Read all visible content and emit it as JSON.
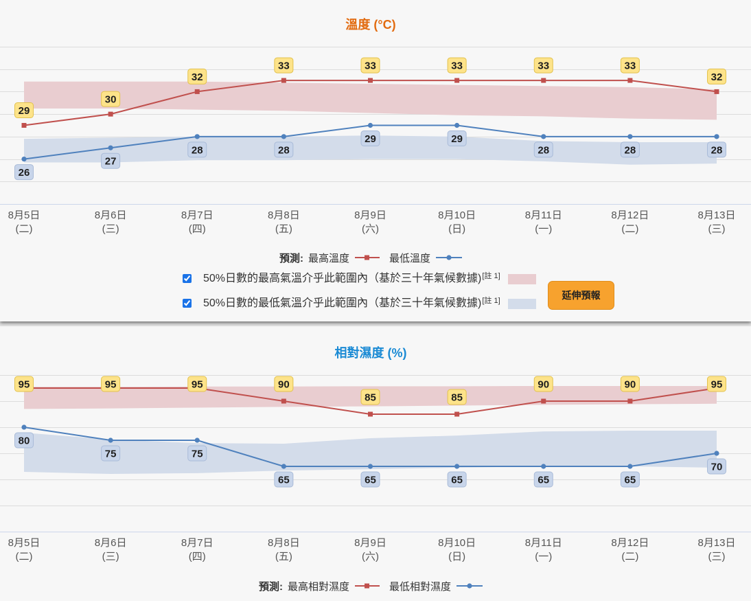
{
  "chart_data": [
    {
      "type": "line",
      "title": "溫度 (°C)",
      "title_color": "#e26b10",
      "categories": [
        "8月5日",
        "8月6日",
        "8月7日",
        "8月8日",
        "8月9日",
        "8月10日",
        "8月11日",
        "8月12日",
        "8月13日"
      ],
      "weekdays": [
        "(二)",
        "(三)",
        "(四)",
        "(五)",
        "(六)",
        "(日)",
        "(一)",
        "(二)",
        "(三)"
      ],
      "series": [
        {
          "name": "最高溫度",
          "values": [
            29,
            30,
            32,
            33,
            33,
            33,
            33,
            33,
            32
          ],
          "color": "#c0504d"
        },
        {
          "name": "最低溫度",
          "values": [
            26,
            27,
            28,
            28,
            29,
            29,
            28,
            28,
            28
          ],
          "color": "#4f81bd"
        }
      ],
      "bands": [
        {
          "label": "50%日數的最高氣溫介乎此範圍內（基於三十年氣候數據)",
          "note": "[註 1]",
          "checked": true,
          "color": "#e9cdd0",
          "upper": [
            32.9,
            32.9,
            32.9,
            32.8,
            32.7,
            32.6,
            32.5,
            32.4,
            32.2
          ],
          "lower": [
            30.5,
            30.5,
            30.4,
            30.3,
            30.1,
            29.9,
            29.8,
            29.6,
            29.5
          ]
        },
        {
          "label": "50%日數的最低氣溫介乎此範圍內（基於三十年氣候數據)",
          "note": "[註 1]",
          "checked": true,
          "color": "#d3dcea",
          "upper": [
            27.8,
            27.9,
            28.0,
            28.0,
            28.1,
            28.0,
            27.6,
            27.5,
            27.5
          ],
          "lower": [
            25.7,
            25.7,
            25.9,
            25.9,
            26.0,
            26.0,
            25.8,
            25.5,
            25.6
          ]
        }
      ],
      "ylim": [
        22,
        36
      ],
      "grid": true,
      "grid_interval": 2,
      "legend_title": "預測:",
      "legend_position": "bottom"
    },
    {
      "type": "line",
      "title": "相對濕度 (%)",
      "title_color": "#1a8ad4",
      "categories": [
        "8月5日",
        "8月6日",
        "8月7日",
        "8月8日",
        "8月9日",
        "8月10日",
        "8月11日",
        "8月12日",
        "8月13日"
      ],
      "weekdays": [
        "(二)",
        "(三)",
        "(四)",
        "(五)",
        "(六)",
        "(日)",
        "(一)",
        "(二)",
        "(三)"
      ],
      "series": [
        {
          "name": "最高相對濕度",
          "values": [
            95,
            95,
            95,
            90,
            85,
            85,
            90,
            90,
            95
          ],
          "color": "#c0504d"
        },
        {
          "name": "最低相對濕度",
          "values": [
            80,
            75,
            75,
            65,
            65,
            65,
            65,
            65,
            70
          ],
          "color": "#4f81bd"
        }
      ],
      "bands": [
        {
          "color": "#e9cdd0",
          "upper": [
            95.5,
            95.5,
            95.6,
            95.6,
            95.7,
            95.7,
            95.8,
            95.8,
            95.8
          ],
          "lower": [
            87.0,
            87.2,
            87.5,
            87.8,
            88.0,
            88.3,
            88.6,
            88.8,
            89.0
          ]
        },
        {
          "color": "#d3dcea",
          "upper": [
            77.9,
            75.3,
            73.9,
            73.7,
            75.8,
            76.8,
            78.4,
            78.7,
            78.7
          ],
          "lower": [
            62.9,
            62.1,
            62.4,
            63.4,
            63.9,
            64.5,
            65.0,
            65.0,
            64.5
          ]
        }
      ],
      "ylim": [
        40,
        100
      ],
      "grid": true,
      "grid_interval": 10,
      "legend_title": "預測:",
      "legend_position": "bottom"
    }
  ],
  "extend_button": {
    "label": "延伸預報",
    "color": "#f7a22e"
  }
}
